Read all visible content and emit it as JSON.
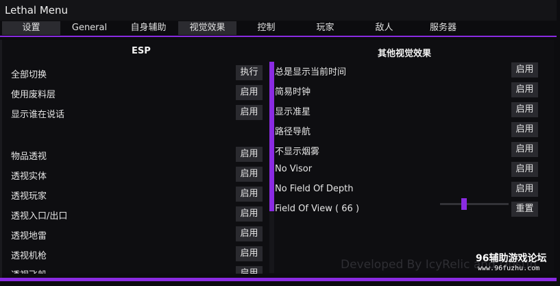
{
  "window": {
    "title": "Lethal Menu"
  },
  "tabs": [
    {
      "label": "设置",
      "active": true
    },
    {
      "label": "General",
      "active": false
    },
    {
      "label": "自身辅助",
      "active": false
    },
    {
      "label": "视觉效果",
      "active": false
    },
    {
      "label": "控制",
      "active": false
    },
    {
      "label": "玩家",
      "active": false
    },
    {
      "label": "敌人",
      "active": false
    },
    {
      "label": "服务器",
      "active": false
    }
  ],
  "left": {
    "title": "ESP",
    "rows": [
      {
        "label": "全部切换",
        "button": "执行"
      },
      {
        "label": "使用废料层",
        "button": "启用"
      },
      {
        "label": "显示谁在说话",
        "button": "启用"
      },
      {
        "label": "物品透视",
        "button": "启用"
      },
      {
        "label": "透视实体",
        "button": "启用"
      },
      {
        "label": "透视玩家",
        "button": "启用"
      },
      {
        "label": "透视入口/出口",
        "button": "启用"
      },
      {
        "label": "透视地雷",
        "button": "启用"
      },
      {
        "label": "透视机枪",
        "button": "启用"
      },
      {
        "label": "透视飞船",
        "button": "启用"
      }
    ]
  },
  "right": {
    "title": "其他视觉效果",
    "rows": [
      {
        "label": "总是显示当前时间",
        "button": "启用"
      },
      {
        "label": "简易时钟",
        "button": "启用"
      },
      {
        "label": "显示准星",
        "button": "启用"
      },
      {
        "label": "路径导航",
        "button": "启用"
      },
      {
        "label": "不显示烟雾",
        "button": "启用"
      },
      {
        "label": "No Visor",
        "button": "启用"
      },
      {
        "label": "No Field Of Depth",
        "button": "启用"
      },
      {
        "label": "Field Of View ( 66 )",
        "button": "重置"
      }
    ],
    "fov_slider": {
      "value": 66,
      "fraction": 0.35
    }
  },
  "watermark": {
    "developer": "Developed By IcyRelic and Dustin",
    "brand": "96辅助游戏论坛",
    "url": "www.96fuzhu.com"
  },
  "colors": {
    "accent": "#8a2be2",
    "background": "#0c0c0f",
    "button": "#2a2a2f"
  }
}
